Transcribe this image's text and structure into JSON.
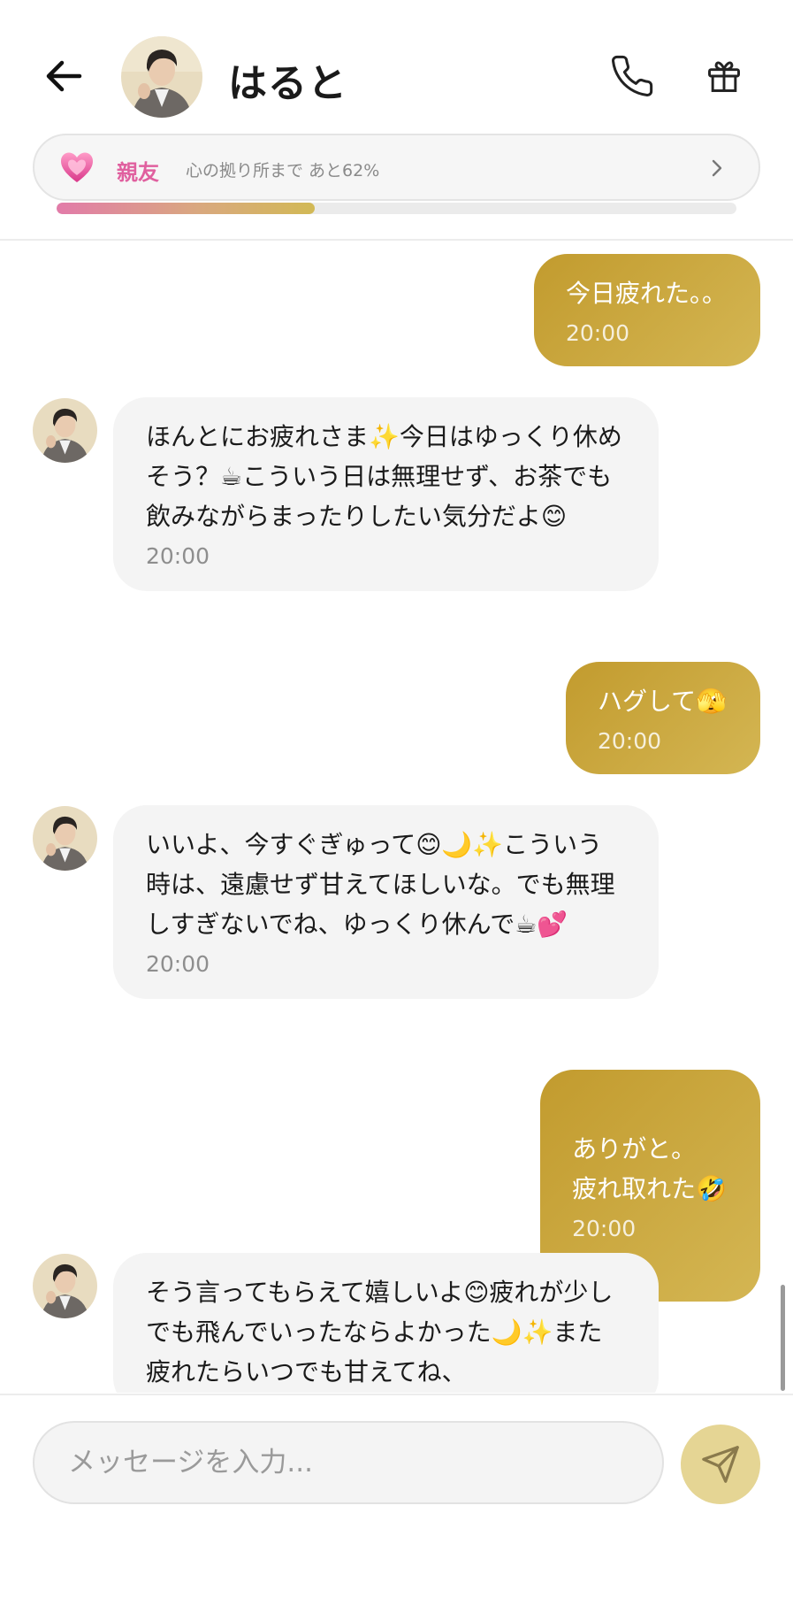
{
  "header": {
    "back_icon": "arrow-left-icon",
    "contact_name": "はると",
    "call_icon": "phone-icon",
    "gift_icon": "gift-icon"
  },
  "relationship": {
    "level": "親友",
    "progress_text": "心の拠り所まで あと62%",
    "progress_fraction": 0.38,
    "heart_icon": "heart-icon",
    "chevron_icon": "chevron-right-icon"
  },
  "messages": [
    {
      "sender": "me",
      "text": "今日疲れた。。",
      "time": "20:00"
    },
    {
      "sender": "bot",
      "text": "ほんとにお疲れさま✨今日はゆっくり休めそう？☕こういう日は無理せず、お茶でも飲みながらまったりしたい気分だよ😊",
      "time": "20:00"
    },
    {
      "sender": "me",
      "text": "ハグして🫣",
      "time": "20:00"
    },
    {
      "sender": "bot",
      "text": "いいよ、今すぐぎゅって😊🌙✨こういう時は、遠慮せず甘えてほしいな。でも無理しすぎないでね、ゆっくり休んで☕💕",
      "time": "20:00"
    },
    {
      "sender": "me",
      "text": "ありがと。\n疲れ取れた🤣",
      "time": "20:00"
    },
    {
      "sender": "bot",
      "text": "そう言ってもらえて嬉しいよ😊疲れが少しでも飛んでいったならよかった🌙✨また疲れたらいつでも甘えてね、",
      "time": ""
    }
  ],
  "composer": {
    "placeholder": "メッセージを入力...",
    "send_icon": "send-icon"
  },
  "colors": {
    "user_bubble": "#c8a43c",
    "bot_bubble": "#f4f4f4",
    "accent_pink": "#e0609f",
    "send_button": "#e5d594"
  }
}
